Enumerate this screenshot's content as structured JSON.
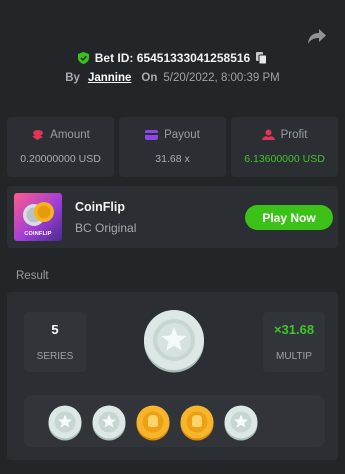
{
  "bet": {
    "id_label": "Bet ID:",
    "id_value": "65451333041258516",
    "by_label": "By",
    "user": "Jannine",
    "on_label": "On",
    "datetime": "5/20/2022, 8:00:39 PM"
  },
  "stats": [
    {
      "label": "Amount",
      "value": "0.20000000 USD",
      "icon": "coins-icon",
      "color": "#e0345a"
    },
    {
      "label": "Payout",
      "value": "31.68 x",
      "icon": "payout-icon",
      "color": "#8a47e6"
    },
    {
      "label": "Profit",
      "value": "6.13600000 USD",
      "icon": "profit-icon",
      "color": "#e0345a"
    }
  ],
  "game": {
    "thumbnail_text": "COINFLIP",
    "name": "CoinFlip",
    "provider": "BC Original",
    "play_label": "Play Now"
  },
  "result": {
    "title": "Result",
    "series_value": "5",
    "series_label": "SERIES",
    "multiplier_value": "×31.68",
    "multiplier_label": "MULTIP",
    "coins": [
      "silver",
      "silver",
      "gold",
      "gold",
      "silver"
    ]
  },
  "colors": {
    "background": "#232629",
    "card": "#2b2f33",
    "accent_green": "#40c32b",
    "button_green": "#3bc117"
  }
}
